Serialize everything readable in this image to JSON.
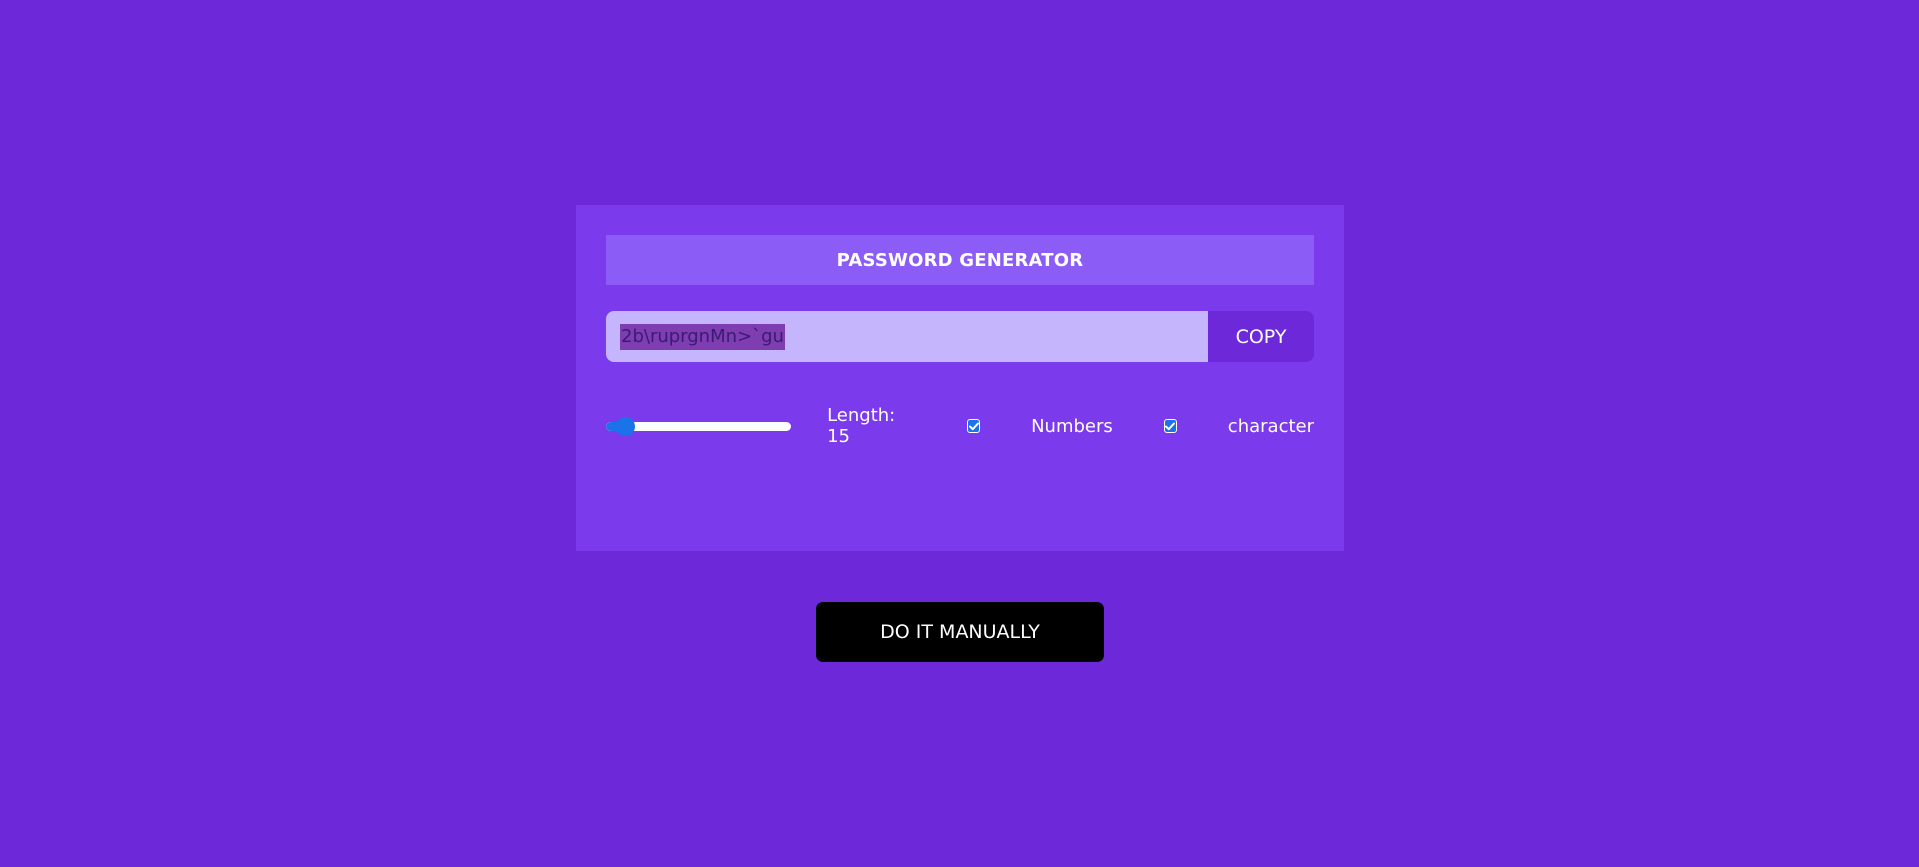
{
  "colors": {
    "background": "#6c28d9",
    "card": "#7c3aed",
    "title_bar": "#8b5cf6",
    "password_field": "#c4b5fd",
    "copy_button": "#6d28d9",
    "slider_accent": "#1a73e8",
    "manual_button": "#000000"
  },
  "generator": {
    "title": "PASSWORD GENERATOR",
    "password_value": "2b\\ruprgnMn>`gu",
    "copy_label": "COPY",
    "slider_fraction": 0.1,
    "length_label": "Length: 15",
    "numbers_checked": true,
    "numbers_label": "Numbers",
    "character_checked": true,
    "character_label": "character"
  },
  "manual_button_label": "DO IT MANUALLY",
  "icons": {
    "checkbox": "check-icon"
  }
}
